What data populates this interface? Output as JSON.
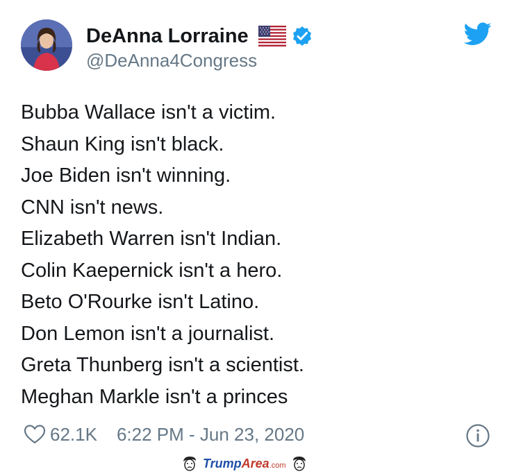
{
  "author": {
    "display_name": "DeAnna Lorraine",
    "handle": "@DeAnna4Congress",
    "flag_icon": "us-flag-icon",
    "verified_icon": "verified-badge-icon"
  },
  "tweet": {
    "lines": [
      "Bubba Wallace isn't a victim.",
      "Shaun King isn't black.",
      "Joe Biden isn't winning.",
      "CNN isn't news.",
      "Elizabeth Warren isn't Indian.",
      "Colin Kaepernick isn't a hero.",
      "Beto O'Rourke isn't Latino.",
      "Don Lemon isn't a journalist.",
      "Greta Thunberg isn't a scientist.",
      "Meghan Markle isn't a princes"
    ],
    "likes": "62.1K",
    "timestamp": "6:22 PM - Jun 23, 2020"
  },
  "watermark": {
    "part1": "Trump",
    "part2": "Area",
    "suffix": ".com"
  },
  "colors": {
    "twitter_blue": "#1da1f2",
    "secondary_text": "#657786",
    "primary_text": "#14171a"
  }
}
